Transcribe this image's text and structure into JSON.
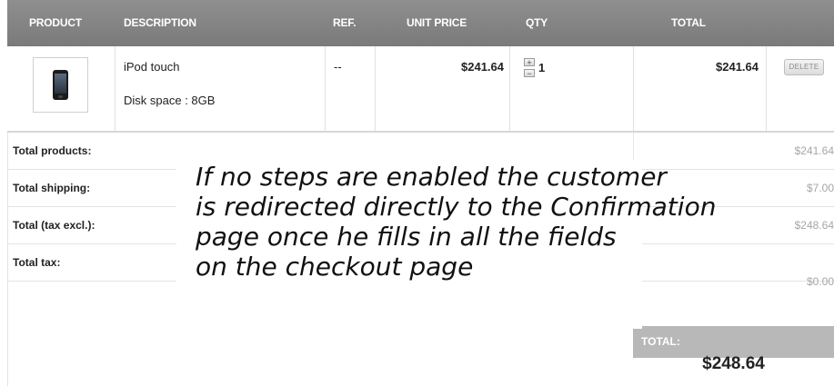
{
  "header": {
    "product": "PRODUCT",
    "description": "DESCRIPTION",
    "ref": "REF.",
    "unit_price": "UNIT PRICE",
    "qty": "QTY",
    "total": "TOTAL"
  },
  "item": {
    "name": "iPod touch",
    "attribute": "Disk space : 8GB",
    "ref": "--",
    "unit_price": "$241.64",
    "qty": "1",
    "qty_plus": "+",
    "qty_minus": "−",
    "total": "$241.64",
    "delete_label": "DELETE",
    "image_icon": "ipod-icon"
  },
  "totals": {
    "products_label": "Total products:",
    "products_value": "$241.64",
    "shipping_label": "Total shipping:",
    "shipping_value": "$7.00",
    "tax_excl_label": "Total (tax excl.):",
    "tax_excl_value": "$248.64",
    "tax_label": "Total tax:",
    "tax_value": "$0.00",
    "grand_label": "TOTAL:",
    "grand_value": "$248.64"
  },
  "annotation": {
    "text": "If no steps are enabled the customer\nis redirected directly to the Confirmation\npage once he fills in all the fields\non the checkout page"
  },
  "colors": {
    "header_bg": "#858585",
    "total_head_bg": "#b8b8b8",
    "muted_value": "#a6a6a6"
  }
}
